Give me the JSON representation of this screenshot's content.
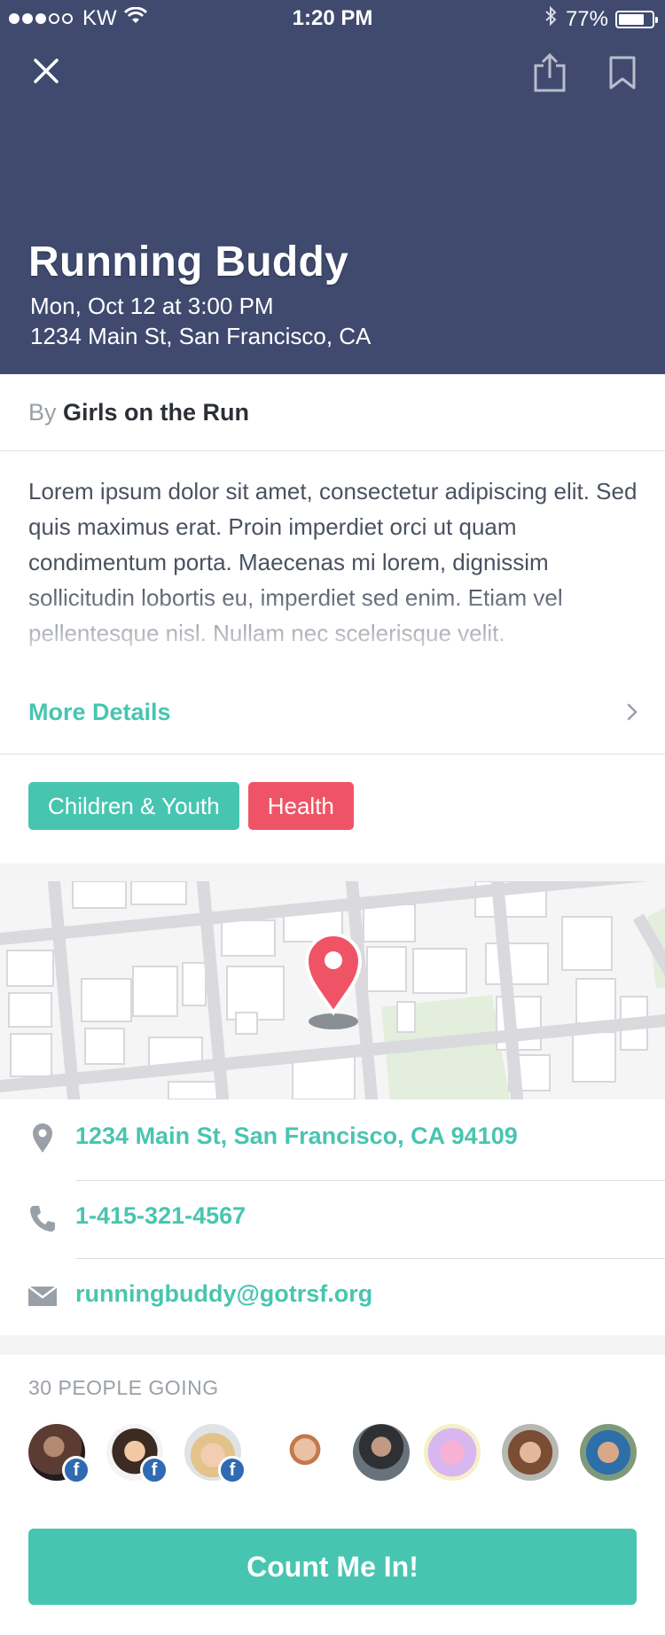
{
  "status_bar": {
    "carrier": "KW",
    "time": "1:20 PM",
    "battery": "77%"
  },
  "header": {
    "close_icon": "close-icon",
    "share_icon": "share-icon",
    "bookmark_icon": "bookmark-icon",
    "title": "Running Buddy",
    "datetime": "Mon, Oct 12 at 3:00 PM",
    "address": "1234 Main St, San Francisco, CA",
    "background_color": "#3f4a6e"
  },
  "organizer": {
    "prefix": "By",
    "name": "Girls on the Run"
  },
  "description": "Lorem ipsum dolor sit amet, consectetur adipiscing elit. Sed quis maximus erat. Proin imperdiet orci ut quam condimentum porta. Maecenas mi lorem, dignissim sollicitudin lobortis eu, imperdiet sed enim. Etiam vel pellentesque nisl. Nullam nec scelerisque velit.",
  "more_details": {
    "label": "More Details",
    "icon": "chevron-right-icon"
  },
  "tags": [
    {
      "label": "Children & Youth",
      "color": "#48c5b0"
    },
    {
      "label": "Health",
      "color": "#ef5466"
    }
  ],
  "map": {
    "pin_icon": "map-pin-icon",
    "pin_color": "#ef5466"
  },
  "contact": {
    "address": "1234 Main St, San Francisco, CA 94109",
    "address_icon": "location-icon",
    "phone": "1-415-321-4567",
    "phone_icon": "phone-icon",
    "email": "runningbuddy@gotrsf.org",
    "email_icon": "mail-icon"
  },
  "attendees": {
    "count_label": "30 PEOPLE GOING",
    "avatars": [
      {
        "name": "attendee-1",
        "facebook": true
      },
      {
        "name": "attendee-2",
        "facebook": true
      },
      {
        "name": "attendee-3",
        "facebook": true
      },
      {
        "name": "attendee-4",
        "facebook": false
      },
      {
        "name": "attendee-5",
        "facebook": false
      },
      {
        "name": "attendee-6",
        "facebook": false
      },
      {
        "name": "attendee-7",
        "facebook": false
      },
      {
        "name": "attendee-8",
        "facebook": false
      }
    ],
    "fb_badge_text": "f"
  },
  "cta": {
    "label": "Count Me In!",
    "color": "#48c5b0"
  },
  "colors": {
    "accent": "#48c5b0",
    "danger": "#ef5466",
    "text": "#4a5260",
    "muted": "#9aa0a8"
  }
}
